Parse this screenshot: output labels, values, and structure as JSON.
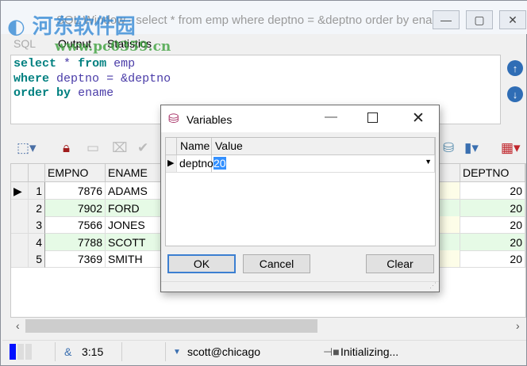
{
  "window": {
    "title": "SQL Window - select * from emp where deptno = &deptno order by ename",
    "minimize": "—",
    "maximize": "▢",
    "close": "✕"
  },
  "tabs": [
    "SQL",
    "Output",
    "Statistics"
  ],
  "editor": {
    "lines": [
      [
        "select",
        "*",
        "from",
        "emp"
      ],
      [
        "where",
        "deptno",
        "=",
        "&deptno"
      ],
      [
        "order",
        "by",
        "ename"
      ]
    ]
  },
  "grid": {
    "columns": [
      "EMPNO",
      "ENAME",
      "DEPTNO"
    ],
    "rows": [
      {
        "n": "1",
        "empno": "7876",
        "ename": "ADAMS",
        "deptno": "20"
      },
      {
        "n": "2",
        "empno": "7902",
        "ename": "FORD",
        "deptno": "20"
      },
      {
        "n": "3",
        "empno": "7566",
        "ename": "JONES",
        "deptno": "20"
      },
      {
        "n": "4",
        "empno": "7788",
        "ename": "SCOTT",
        "deptno": "20"
      },
      {
        "n": "5",
        "empno": "7369",
        "ename": "SMITH",
        "deptno": "20"
      }
    ]
  },
  "status": {
    "amp": "&",
    "position": "3:15",
    "connection": "scott@chicago",
    "state": "Initializing..."
  },
  "dialog": {
    "title": "Variables",
    "columns": [
      "Name",
      "Value"
    ],
    "row": {
      "name": "deptno",
      "value": "20"
    },
    "ok": "OK",
    "cancel": "Cancel",
    "clear": "Clear"
  },
  "watermark": {
    "text": "河东软件园",
    "url": "www.pc0359.cn"
  }
}
